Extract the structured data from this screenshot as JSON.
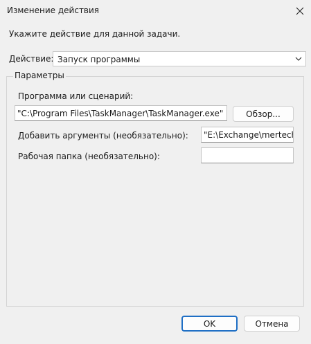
{
  "window": {
    "title": "Изменение действия"
  },
  "dialog": {
    "instruction": "Укажите действие для данной задачи.",
    "action_label": "Действие:",
    "action_value": "Запуск программы",
    "group_title": "Параметры",
    "program_label": "Программа или сценарий:",
    "program_value": "\"C:\\Program Files\\TaskManager\\TaskManager.exe\"",
    "browse_label": "Обзор...",
    "args_label": "Добавить аргументы (необязательно):",
    "args_value": "\"E:\\Exchange\\mertech\\t",
    "dir_label": "Рабочая папка (необязательно):",
    "dir_value": ""
  },
  "buttons": {
    "ok": "OK",
    "cancel": "Отмена"
  },
  "colors": {
    "accent": "#1f6fc5",
    "background": "#f0f0f0"
  },
  "icons": {
    "close": "close-icon",
    "dropdown": "chevron-down-icon"
  }
}
